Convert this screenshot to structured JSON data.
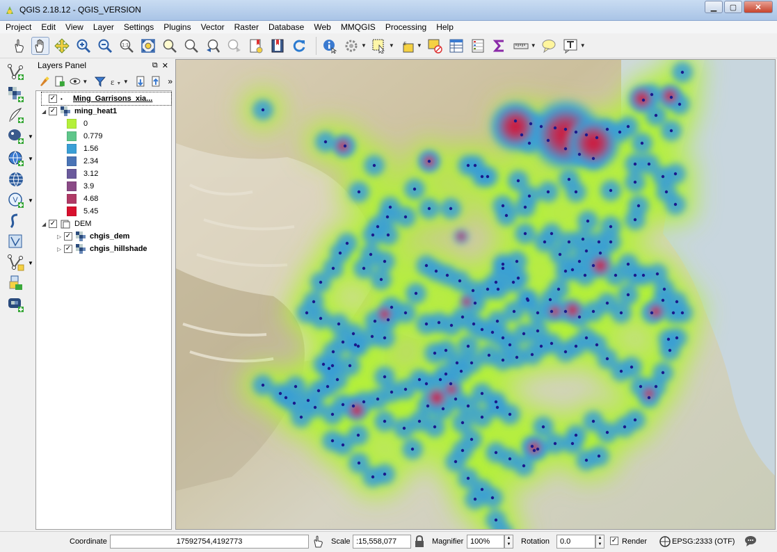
{
  "window": {
    "title": "QGIS 2.18.12 - QGIS_VERSION",
    "controls": [
      "minimize",
      "maximize",
      "close"
    ]
  },
  "menubar": {
    "items": [
      "Project",
      "Edit",
      "View",
      "Layer",
      "Settings",
      "Plugins",
      "Vector",
      "Raster",
      "Database",
      "Web",
      "MMQGIS",
      "Processing",
      "Help"
    ]
  },
  "toolbar": {
    "icons": [
      "touch-icon",
      "pan-icon",
      "pan-to-selection-icon",
      "zoom-in-icon",
      "zoom-out-icon",
      "zoom-native-icon",
      "zoom-full-icon",
      "zoom-to-selection-icon",
      "zoom-to-layer-icon",
      "zoom-last-icon",
      "zoom-next-icon",
      "new-bookmark-icon",
      "show-bookmarks-icon",
      "refresh-icon",
      "identify-icon",
      "action-icon",
      "select-features-icon",
      "select-by-expression-icon",
      "deselect-icon",
      "attribute-table-icon",
      "field-calculator-icon",
      "statistics-sum-icon",
      "measure-icon",
      "map-tips-icon",
      "text-annotation-icon"
    ]
  },
  "left_tools": {
    "icons": [
      "add-vector-layer-icon",
      "add-raster-layer-icon",
      "add-delimited-text-icon",
      "add-postgis-icon",
      "add-wms-icon",
      "add-wfs-icon",
      "add-wcs-icon",
      "add-spatialite-icon",
      "new-shapefile-icon",
      "new-spatialite-icon",
      "add-virtual-layer-icon",
      "add-raster-tile-icon"
    ]
  },
  "layers_panel": {
    "title": "Layers Panel",
    "layers": [
      {
        "name": "Ming_Garrisons_xia...",
        "checked": true,
        "type": "point",
        "selected": true
      },
      {
        "name": "ming_heat1",
        "checked": true,
        "type": "raster",
        "expanded": true
      }
    ],
    "legend": [
      {
        "label": "0",
        "color": "#b4f03a"
      },
      {
        "label": "0.779",
        "color": "#5ec68a"
      },
      {
        "label": "1.56",
        "color": "#3a9fd6"
      },
      {
        "label": "2.34",
        "color": "#4a74b6"
      },
      {
        "label": "3.12",
        "color": "#6a5a9c"
      },
      {
        "label": "3.9",
        "color": "#8a4a86"
      },
      {
        "label": "4.68",
        "color": "#b03a66"
      },
      {
        "label": "5.45",
        "color": "#d8102e"
      }
    ],
    "group": {
      "name": "DEM",
      "checked": true,
      "children": [
        {
          "name": "chgis_dem",
          "checked": true
        },
        {
          "name": "chgis_hillshade",
          "checked": true
        }
      ]
    }
  },
  "statusbar": {
    "coordinate_label": "Coordinate",
    "coordinate_value": "17592754,4192773",
    "scale_label": "Scale",
    "scale_value": ":15,558,077",
    "magnifier_label": "Magnifier",
    "magnifier_value": "100%",
    "rotation_label": "Rotation",
    "rotation_value": "0.0",
    "render_label": "Render",
    "render_checked": true,
    "crs": "EPSG:2333 (OTF)"
  },
  "map": {
    "heat_low_color": "#b4f03a",
    "heat_mid_color": "#3a9fd6",
    "heat_high_color": "#d8102e",
    "point_color": "#1a1a8c"
  }
}
